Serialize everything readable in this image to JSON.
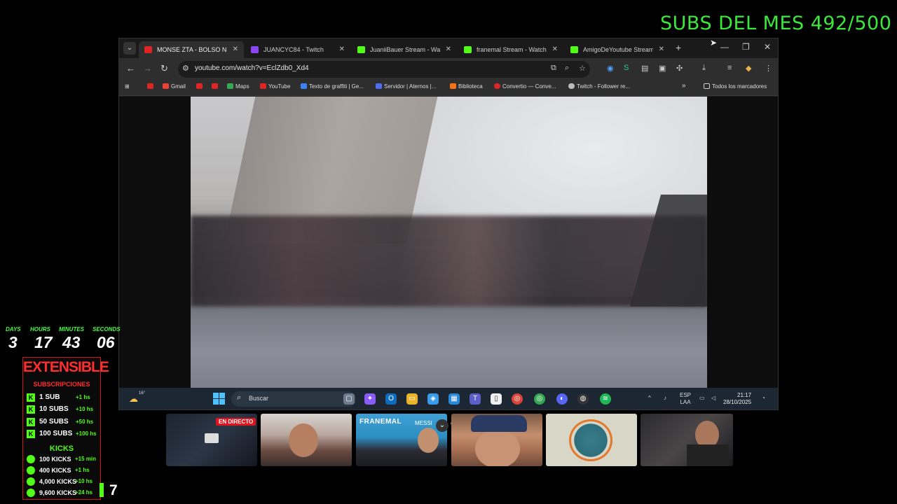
{
  "overlay": {
    "subs_month": "SUBS DEL MES 492/500"
  },
  "browser": {
    "tabs": [
      {
        "title": "MONSE ZTA - BOLSO N",
        "favicon": "youtube-icon",
        "active": true
      },
      {
        "title": "JUANCYC84 - Twitch",
        "favicon": "twitch-icon",
        "active": false
      },
      {
        "title": "JuaniiBauer Stream - Watch",
        "favicon": "kick-icon",
        "active": false
      },
      {
        "title": "franemal Stream - Watch Li",
        "favicon": "kick-icon",
        "active": false
      },
      {
        "title": "AmigoDeYoutube Stream -",
        "favicon": "kick-icon",
        "active": false
      }
    ],
    "url": "youtube.com/watch?v=EclZdb0_Xd4",
    "bookmarks": [
      {
        "label": "",
        "icon": "youtube-icon"
      },
      {
        "label": "Gmail",
        "icon": "gmail-icon"
      },
      {
        "label": "",
        "icon": "youtube-icon"
      },
      {
        "label": "",
        "icon": "youtube-icon"
      },
      {
        "label": "Maps",
        "icon": "maps-icon"
      },
      {
        "label": "YouTube",
        "icon": "youtube-icon"
      },
      {
        "label": "Texto de graffiti | Ge...",
        "icon": "graffiti-icon"
      },
      {
        "label": "Servidor | Aternos |...",
        "icon": "server-icon"
      },
      {
        "label": "Biblioteca",
        "icon": "library-icon"
      },
      {
        "label": "Convertio — Conve...",
        "icon": "convertio-icon"
      },
      {
        "label": "Twitch - Follower re...",
        "icon": "globe-icon"
      }
    ],
    "all_bookmarks": "Todos los marcadores",
    "chevron": "»"
  },
  "taskbar": {
    "temperature": "16°",
    "search_placeholder": "Buscar",
    "lang_top": "ESP",
    "lang_bottom": "LAA",
    "time": "21:17",
    "date": "28/10/2025"
  },
  "timer": {
    "labels": [
      "DAYS",
      "HOURS",
      "MINUTES",
      "SECONDS"
    ],
    "values": [
      "3",
      "17",
      "43",
      "06"
    ]
  },
  "extensible": {
    "title": "EXTENSIBLE",
    "subtitle": "SUBSCRIPCIONES",
    "subs": [
      {
        "label": "1 SUB",
        "value": "+1 hs"
      },
      {
        "label": "10 SUBS",
        "value": "+10 hs"
      },
      {
        "label": "50 SUBS",
        "value": "+50 hs"
      },
      {
        "label": "100 SUBS",
        "value": "+100 hs"
      }
    ],
    "kicks_title": "KICKS",
    "kicks": [
      {
        "label": "100 KICKS",
        "value": "+15 min"
      },
      {
        "label": "400 KICKS",
        "value": "+1 hs"
      },
      {
        "label": "4,000 KICKS",
        "value": "+10 hs"
      },
      {
        "label": "9,600 KICKS",
        "value": "+24 hs"
      }
    ],
    "side_number": "7"
  },
  "cams": {
    "live_badge": "EN DIRECTO",
    "fran_text": "FRANEMAL",
    "fran_sub": "MESSI"
  },
  "colors": {
    "accent_green": "#3ce83c",
    "kick_green": "#53fc18",
    "extensible_red": "#ff2e2e",
    "youtube_red": "#e02424",
    "twitch_purple": "#8b45f5"
  }
}
